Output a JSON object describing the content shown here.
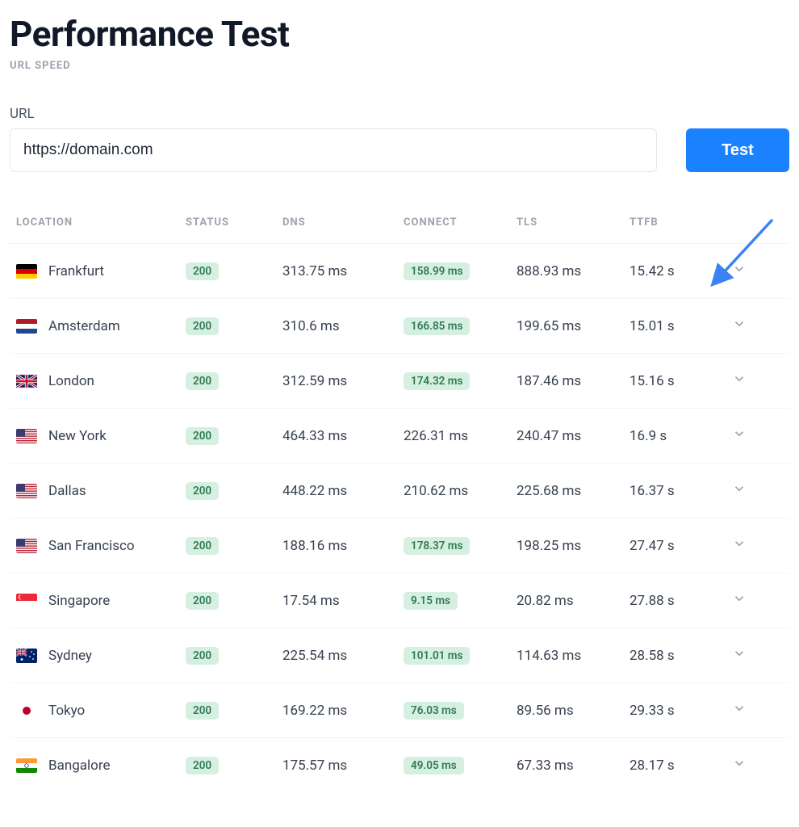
{
  "header": {
    "title": "Performance Test",
    "subtitle": "URL SPEED"
  },
  "form": {
    "url_label": "URL",
    "url_value": "https://domain.com",
    "test_button": "Test"
  },
  "table": {
    "columns": {
      "location": "LOCATION",
      "status": "STATUS",
      "dns": "DNS",
      "connect": "CONNECT",
      "tls": "TLS",
      "ttfb": "TTFB"
    },
    "rows": [
      {
        "location": "Frankfurt",
        "flag": "de",
        "status": "200",
        "dns": "313.75 ms",
        "connect": "158.99 ms",
        "connect_highlight": true,
        "tls": "888.93 ms",
        "ttfb": "15.42 s"
      },
      {
        "location": "Amsterdam",
        "flag": "nl",
        "status": "200",
        "dns": "310.6 ms",
        "connect": "166.85 ms",
        "connect_highlight": true,
        "tls": "199.65 ms",
        "ttfb": "15.01 s"
      },
      {
        "location": "London",
        "flag": "gb",
        "status": "200",
        "dns": "312.59 ms",
        "connect": "174.32 ms",
        "connect_highlight": true,
        "tls": "187.46 ms",
        "ttfb": "15.16 s"
      },
      {
        "location": "New York",
        "flag": "us",
        "status": "200",
        "dns": "464.33 ms",
        "connect": "226.31 ms",
        "connect_highlight": false,
        "tls": "240.47 ms",
        "ttfb": "16.9 s"
      },
      {
        "location": "Dallas",
        "flag": "us",
        "status": "200",
        "dns": "448.22 ms",
        "connect": "210.62 ms",
        "connect_highlight": false,
        "tls": "225.68 ms",
        "ttfb": "16.37 s"
      },
      {
        "location": "San Francisco",
        "flag": "us",
        "status": "200",
        "dns": "188.16 ms",
        "connect": "178.37 ms",
        "connect_highlight": true,
        "tls": "198.25 ms",
        "ttfb": "27.47 s"
      },
      {
        "location": "Singapore",
        "flag": "sg",
        "status": "200",
        "dns": "17.54 ms",
        "connect": "9.15 ms",
        "connect_highlight": true,
        "tls": "20.82 ms",
        "ttfb": "27.88 s"
      },
      {
        "location": "Sydney",
        "flag": "au",
        "status": "200",
        "dns": "225.54 ms",
        "connect": "101.01 ms",
        "connect_highlight": true,
        "tls": "114.63 ms",
        "ttfb": "28.58 s"
      },
      {
        "location": "Tokyo",
        "flag": "jp",
        "status": "200",
        "dns": "169.22 ms",
        "connect": "76.03 ms",
        "connect_highlight": true,
        "tls": "89.56 ms",
        "ttfb": "29.33 s"
      },
      {
        "location": "Bangalore",
        "flag": "in",
        "status": "200",
        "dns": "175.57 ms",
        "connect": "49.05 ms",
        "connect_highlight": true,
        "tls": "67.33 ms",
        "ttfb": "28.17 s"
      }
    ]
  },
  "colors": {
    "accent": "#1a82ff",
    "pill_bg": "#d5efe0",
    "pill_fg": "#2f7a52",
    "arrow": "#3b82f6"
  }
}
